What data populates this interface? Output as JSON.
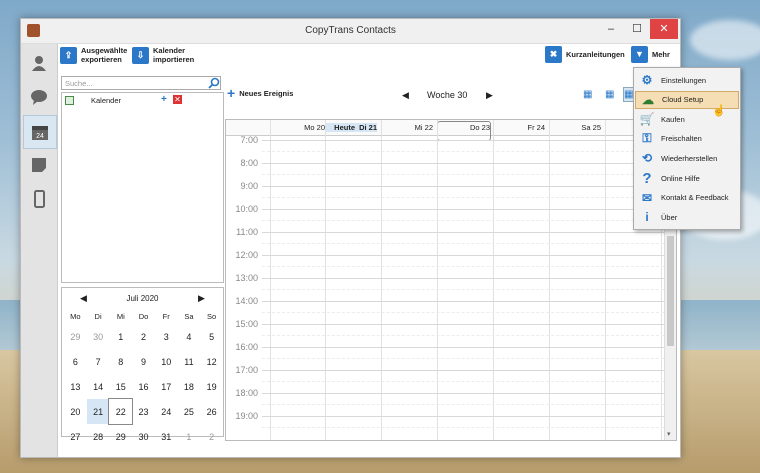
{
  "window": {
    "title": "CopyTrans Contacts",
    "min": "–",
    "max": "☐",
    "close": "✕"
  },
  "toolbar": {
    "export_label": "Ausgewählte\nexportieren",
    "import_label": "Kalender\nimportieren",
    "guides_label": "Kurzanleitungen",
    "more_label": "Mehr"
  },
  "sidebar": {
    "search_placeholder": "Suche...",
    "calendar_item": "Kalender"
  },
  "calendar": {
    "new_event": "Neues Ereignis",
    "week_label": "Woche 30",
    "days": [
      "Mo 20",
      "Heute",
      "Di 21",
      "Mi 22",
      "Do 23",
      "Fr 24",
      "Sa 25"
    ],
    "hours": [
      "7:00",
      "8:00",
      "9:00",
      "10:00",
      "11:00",
      "12:00",
      "13:00",
      "14:00",
      "15:00",
      "16:00",
      "17:00",
      "18:00",
      "19:00"
    ]
  },
  "mini_calendar": {
    "month": "Juli 2020",
    "weekdays": [
      "Mo",
      "Di",
      "Mi",
      "Do",
      "Fr",
      "Sa",
      "So"
    ],
    "weeks": [
      [
        "29",
        "30",
        "1",
        "2",
        "3",
        "4",
        "5"
      ],
      [
        "6",
        "7",
        "8",
        "9",
        "10",
        "11",
        "12"
      ],
      [
        "13",
        "14",
        "15",
        "16",
        "17",
        "18",
        "19"
      ],
      [
        "20",
        "21",
        "22",
        "23",
        "24",
        "25",
        "26"
      ],
      [
        "27",
        "28",
        "29",
        "30",
        "31",
        "1",
        "2"
      ]
    ]
  },
  "menu": {
    "items": [
      "Einstellungen",
      "Cloud Setup",
      "Kaufen",
      "Freischalten",
      "Wiederherstellen",
      "Online Hilfe",
      "Kontakt & Feedback",
      "Über"
    ]
  },
  "colors": {
    "accent": "#2b78c8",
    "highlight": "#f5deb3",
    "today": "#d6e6f5"
  }
}
